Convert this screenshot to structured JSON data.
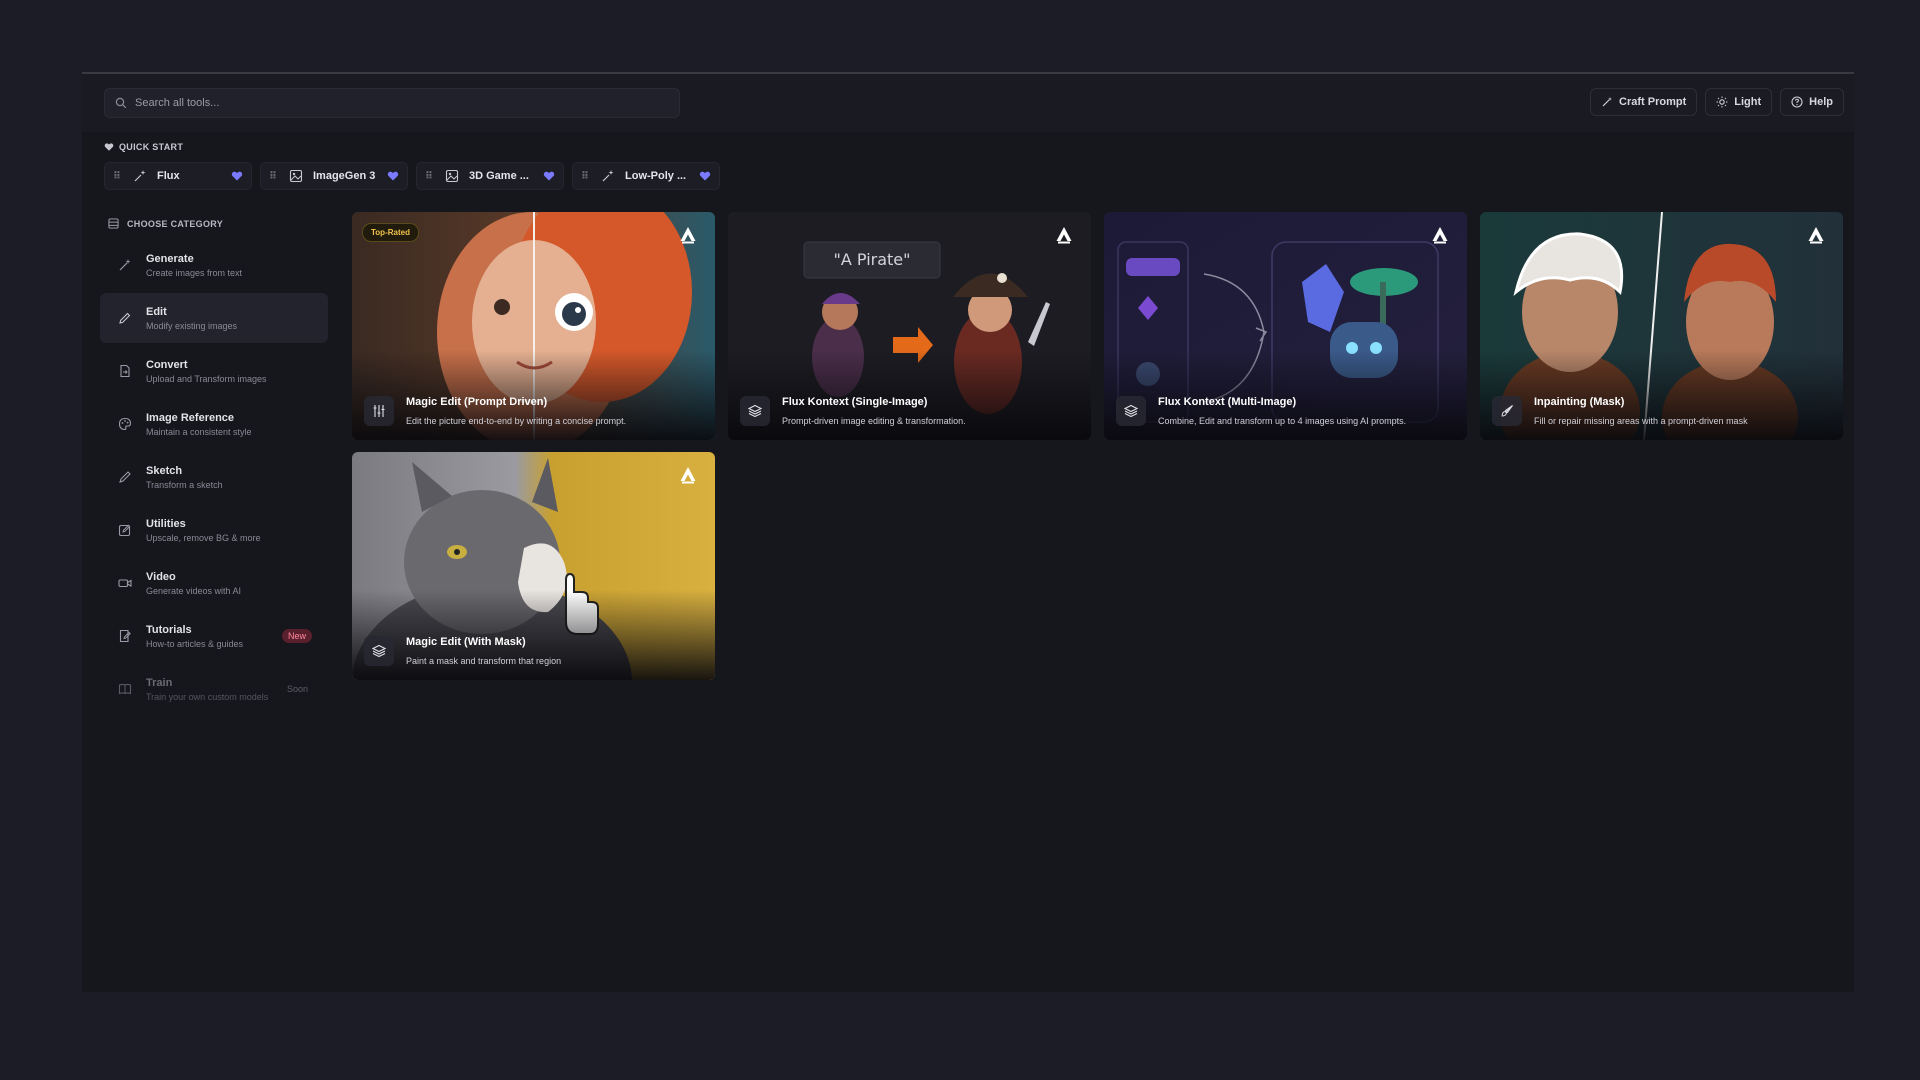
{
  "search": {
    "placeholder": "Search all tools..."
  },
  "header": {
    "craft_prompt": "Craft Prompt",
    "light": "Light",
    "help": "Help"
  },
  "quick_start": {
    "label": "QUICK START",
    "items": [
      {
        "name": "Flux",
        "icon": "sparkle-icon"
      },
      {
        "name": "ImageGen 3",
        "icon": "image-icon"
      },
      {
        "name": "3D Game ...",
        "icon": "image-icon"
      },
      {
        "name": "Low-Poly ...",
        "icon": "sparkle-icon"
      }
    ]
  },
  "category": {
    "label": "CHOOSE CATEGORY",
    "items": [
      {
        "title": "Generate",
        "sub": "Create images from text",
        "icon": "magic-wand-icon"
      },
      {
        "title": "Edit",
        "sub": "Modify existing images",
        "icon": "pencil-icon",
        "active": true
      },
      {
        "title": "Convert",
        "sub": "Upload and Transform images",
        "icon": "file-convert-icon"
      },
      {
        "title": "Image Reference",
        "sub": "Maintain a consistent style",
        "icon": "palette-icon"
      },
      {
        "title": "Sketch",
        "sub": "Transform a sketch",
        "icon": "pen-icon"
      },
      {
        "title": "Utilities",
        "sub": "Upscale, remove BG & more",
        "icon": "edit-square-icon"
      },
      {
        "title": "Video",
        "sub": "Generate videos with AI",
        "icon": "video-camera-icon"
      },
      {
        "title": "Tutorials",
        "sub": "How-to articles & guides",
        "icon": "book-edit-icon",
        "badge": "New"
      },
      {
        "title": "Train",
        "sub": "Train your own custom models",
        "icon": "book-icon",
        "badge": "Soon",
        "disabled": true
      }
    ]
  },
  "cards": [
    {
      "title": "Magic Edit (Prompt Driven)",
      "desc": "Edit the picture end-to-end by writing a concise prompt.",
      "badge": "Top-Rated",
      "icon": "sliders-icon"
    },
    {
      "title": "Flux Kontext (Single-Image)",
      "desc": "Prompt-driven image editing & transformation.",
      "art_text": "\"A Pirate\"",
      "icon": "layers-icon"
    },
    {
      "title": "Flux Kontext (Multi-Image)",
      "desc": "Combine, Edit and transform up to 4 images using AI prompts.",
      "icon": "layers-icon"
    },
    {
      "title": "Inpainting (Mask)",
      "desc": "Fill or repair missing areas with a prompt-driven mask",
      "icon": "brush-icon"
    },
    {
      "title": "Magic Edit (With Mask)",
      "desc": "Paint a mask and transform that region",
      "icon": "layers-icon"
    }
  ],
  "colors": {
    "accent_heart": "#7b7bff",
    "badge_top_rated": "#f0c24a",
    "badge_new": "#ff8aa0"
  }
}
